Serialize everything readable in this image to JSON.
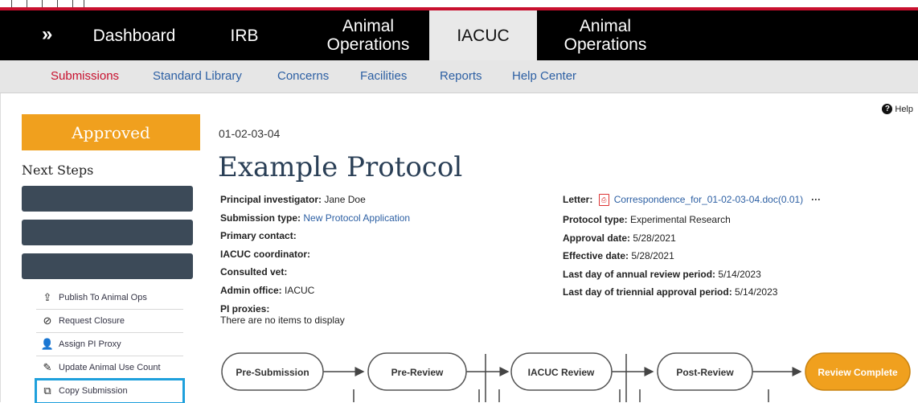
{
  "nav": {
    "chevron": "»",
    "tabs": [
      "Dashboard",
      "IRB",
      "Animal\nOperations",
      "IACUC",
      "Animal\nOperations"
    ],
    "active_tab": "IACUC"
  },
  "subnav": {
    "items": [
      "Submissions",
      "Standard Library",
      "Concerns",
      "Facilities",
      "Reports",
      "Help Center"
    ],
    "active": "Submissions"
  },
  "help_label": "Help",
  "sidebar": {
    "status": "Approved",
    "status_color": "#f0a01e",
    "next_steps_heading": "Next Steps",
    "actions": [
      {
        "label": "Publish To Animal Ops",
        "icon": "publish-icon"
      },
      {
        "label": "Request Closure",
        "icon": "prohibit-icon"
      },
      {
        "label": "Assign PI Proxy",
        "icon": "add-user-icon"
      },
      {
        "label": "Update Animal Use Count",
        "icon": "pencil-icon"
      },
      {
        "label": "Copy Submission",
        "icon": "copy-icon"
      }
    ],
    "selected_action": "Copy Submission",
    "highlight_color": "#1ea0dc"
  },
  "protocol": {
    "id": "01-02-03-04",
    "title": "Example Protocol",
    "left": [
      {
        "label": "Principal investigator:",
        "value": "Jane Doe"
      },
      {
        "label": "Submission type:",
        "value": "New Protocol Application",
        "link": true
      },
      {
        "label": "Primary contact:",
        "value": ""
      },
      {
        "label": "IACUC coordinator:",
        "value": ""
      },
      {
        "label": "Consulted vet:",
        "value": ""
      },
      {
        "label": "Admin office:",
        "value": "IACUC"
      },
      {
        "label": "PI proxies:",
        "value": ""
      }
    ],
    "pi_proxies_empty": "There are no items to display",
    "right": {
      "letter_label": "Letter:",
      "letter_file": "Correspondence_for_01-02-03-04.doc(0.01)",
      "letter_more": "···",
      "rows": [
        {
          "label": "Protocol type:",
          "value": "Experimental Research"
        },
        {
          "label": "Approval date:",
          "value": "5/28/2021"
        },
        {
          "label": "Effective date:",
          "value": "5/28/2021"
        },
        {
          "label": "Last day of annual review period:",
          "value": "5/14/2023"
        },
        {
          "label": "Last day of triennial approval period:",
          "value": "5/14/2023"
        }
      ]
    }
  },
  "workflow": {
    "stages": [
      "Pre-Submission",
      "Pre-Review",
      "IACUC Review",
      "Post-Review",
      "Review Complete"
    ],
    "current": "Review Complete",
    "current_color": "#f0a01e"
  }
}
